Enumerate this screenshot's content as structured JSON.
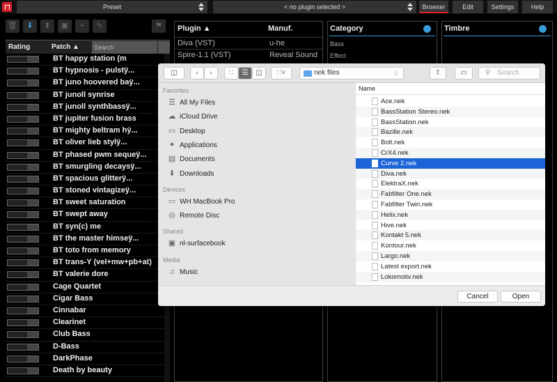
{
  "topbar": {
    "preset_label": "Preset",
    "plugin_select": "< no plugin selected >",
    "buttons": [
      "Browser",
      "Edit",
      "Settings",
      "Help"
    ]
  },
  "list_header": {
    "rating": "Rating",
    "patch": "Patch ▲",
    "search_placeholder": "Search"
  },
  "patches": [
    "BT happy station (m",
    "BT hypnosis - pulstÿ...",
    "BT juno hoovered baÿ...",
    "BT junoll synrise",
    "BT junoll synthbassÿ...",
    "BT jupiter fusion brass",
    "BT mighty beltram hÿ...",
    "BT oliver lieb stylÿ...",
    "BT phased pwm sequeÿ...",
    "BT smurgling decaysÿ...",
    "BT spacious glitterÿ...",
    "BT stoned vintagizeÿ...",
    "BT sweet saturation",
    "BT swept away",
    "BT syn(c) me",
    "BT the master himseÿ...",
    "BT toto from memory",
    "BT trans-Y (vel+mw+pb+at)",
    "BT valerie dore",
    "Cage Quartet",
    "Cigar Bass",
    "Cinnabar",
    "Clearinet",
    "Club Bass",
    "D-Bass",
    "DarkPhase",
    "Death by beauty"
  ],
  "plugin_panel": {
    "col_plugin": "Plugin ▲",
    "col_manuf": "Manuf.",
    "rows": [
      {
        "name": "Diva (VST)",
        "manuf": "u-he"
      },
      {
        "name": "Spire-1.1 (VST)",
        "manuf": "Reveal Sound"
      }
    ]
  },
  "category_panel": {
    "title": "Category",
    "items": [
      "Bass",
      "Effect"
    ]
  },
  "timbre_panel": {
    "title": "Timbre"
  },
  "dialog": {
    "path": "nek files",
    "search_placeholder": "Search",
    "sections": [
      {
        "title": "Favorites",
        "items": [
          {
            "icon": "☰",
            "label": "All My Files"
          },
          {
            "icon": "☁",
            "label": "iCloud Drive"
          },
          {
            "icon": "▭",
            "label": "Desktop"
          },
          {
            "icon": "✦",
            "label": "Applications"
          },
          {
            "icon": "▤",
            "label": "Documents"
          },
          {
            "icon": "⬇",
            "label": "Downloads"
          }
        ]
      },
      {
        "title": "Devices",
        "items": [
          {
            "icon": "▭",
            "label": "WH MacBook Pro"
          },
          {
            "icon": "◎",
            "label": "Remote Disc"
          }
        ]
      },
      {
        "title": "Shared",
        "items": [
          {
            "icon": "▣",
            "label": "nl-surfacebook"
          }
        ]
      },
      {
        "title": "Media",
        "items": [
          {
            "icon": "♫",
            "label": "Music"
          }
        ]
      }
    ],
    "column_name": "Name",
    "files": [
      "Ace.nek",
      "BassStation Stereo.nek",
      "BassStation.nek",
      "Bazille.nek",
      "Bolt.nek",
      "CrX4.nek",
      "Curve 2.nek",
      "Diva.nek",
      "ElektraX.nek",
      "Fabfilter One.nek",
      "Fabfilter Twin.nek",
      "Helix.nek",
      "Hive.nek",
      "Kontakt 5.nek",
      "Kontour.nek",
      "Largo.nek",
      "Latest export.nek",
      "Lokomotiv.nek"
    ],
    "selected_file": "Curve 2.nek",
    "cancel": "Cancel",
    "open": "Open"
  },
  "colors": {
    "accent_red": "#d8202a",
    "accent_blue": "#3a9bd9",
    "selection_blue": "#1b64d8"
  }
}
